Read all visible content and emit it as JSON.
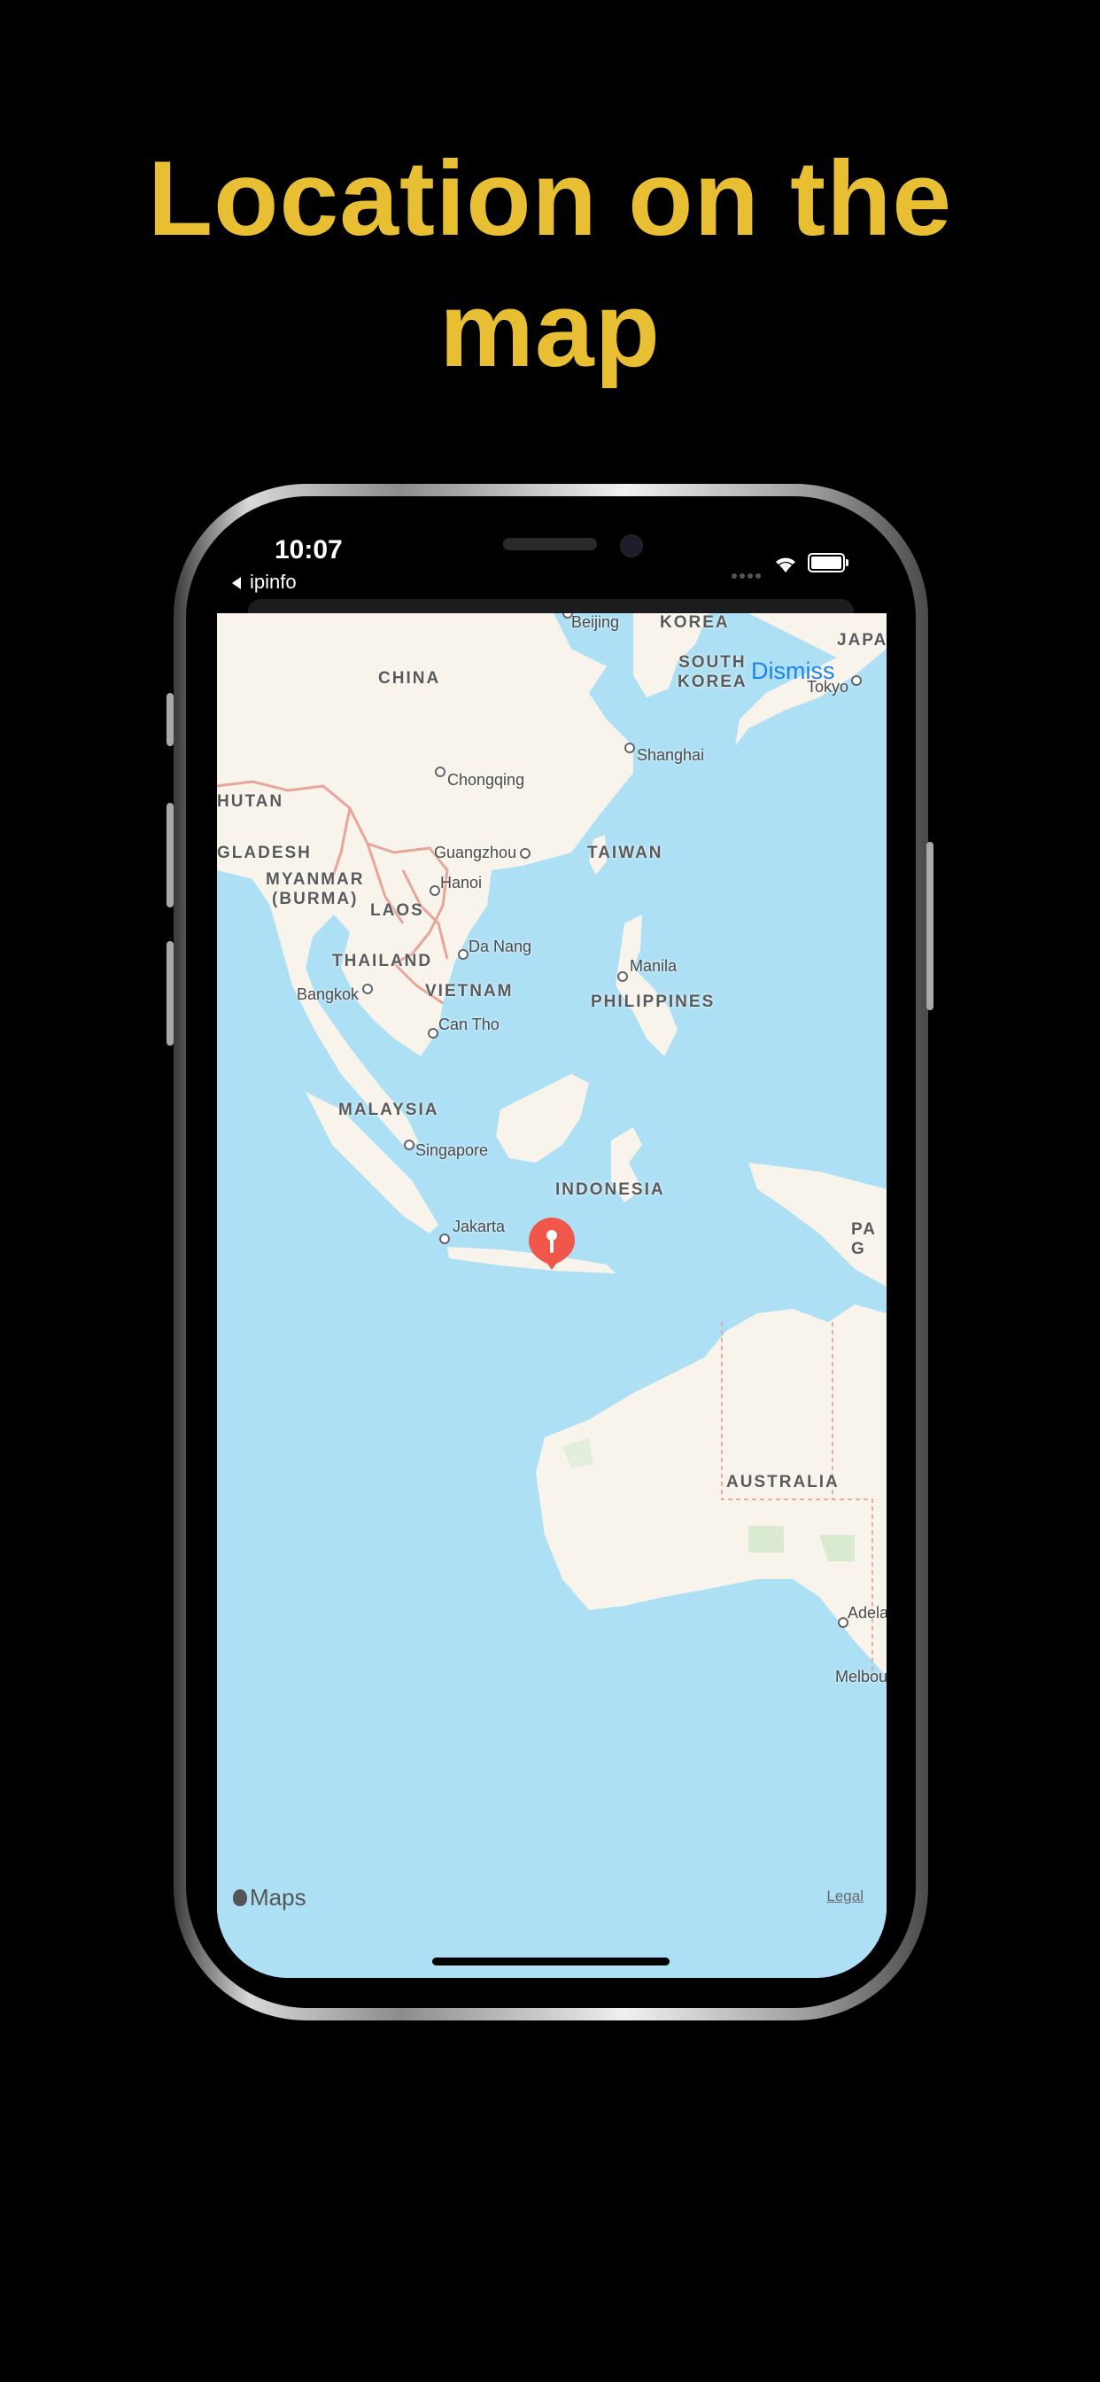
{
  "headline": {
    "line1": "Location on the",
    "line2": "map"
  },
  "status_bar": {
    "time": "10:07",
    "back_label": "ipinfo"
  },
  "map": {
    "dismiss_label": "Dismiss",
    "maps_brand": "Maps",
    "legal_label": "Legal",
    "countries": {
      "china": "CHINA",
      "korea": "KOREA",
      "south_korea": "SOUTH\nKOREA",
      "japan": "JAPA",
      "bhutan": "HUTAN",
      "bangladesh": "GLADESH",
      "myanmar": "MYANMAR\n(BURMA)",
      "laos": "LAOS",
      "taiwan": "TAIWAN",
      "thailand": "THAILAND",
      "vietnam": "VIETNAM",
      "philippines": "PHILIPPINES",
      "malaysia": "MALAYSIA",
      "indonesia": "INDONESIA",
      "png": "PA\nG",
      "australia": "AUSTRALIA"
    },
    "cities": {
      "beijing": "Beijing",
      "tokyo": "Tokyo",
      "shanghai": "Shanghai",
      "chongqing": "Chongqing",
      "guangzhou": "Guangzhou",
      "hanoi": "Hanoi",
      "da_nang": "Da Nang",
      "manila": "Manila",
      "bangkok": "Bangkok",
      "can_tho": "Can Tho",
      "singapore": "Singapore",
      "jakarta": "Jakarta",
      "adelaide": "Adela",
      "melbourne": "Melbou"
    },
    "colors": {
      "water": "#aee0f5",
      "land": "#f8f4ec",
      "pin": "#f0574a",
      "accent": "#e8bf33",
      "link": "#1f84e8"
    }
  }
}
